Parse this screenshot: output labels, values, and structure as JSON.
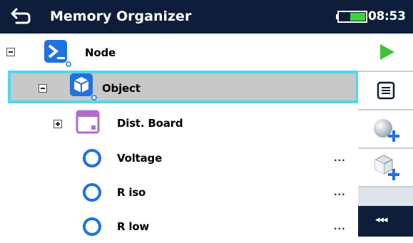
{
  "header": {
    "title": "Memory Organizer",
    "time": "08:53"
  },
  "tree": {
    "node": {
      "label": "Node"
    },
    "object": {
      "label": "Object"
    },
    "board": {
      "label": "Dist. Board"
    },
    "tests": [
      {
        "label": "Voltage",
        "dots": "..."
      },
      {
        "label": "R iso",
        "dots": "..."
      },
      {
        "label": "R low",
        "dots": "..."
      }
    ]
  },
  "sidebar": {
    "collapse_label": "◂◂◂"
  },
  "colors": {
    "header": "#0e1e3a",
    "accent": "#1f72e0",
    "selection": "#50d8ea",
    "play": "#39c43a",
    "board": "#b06cc8"
  }
}
